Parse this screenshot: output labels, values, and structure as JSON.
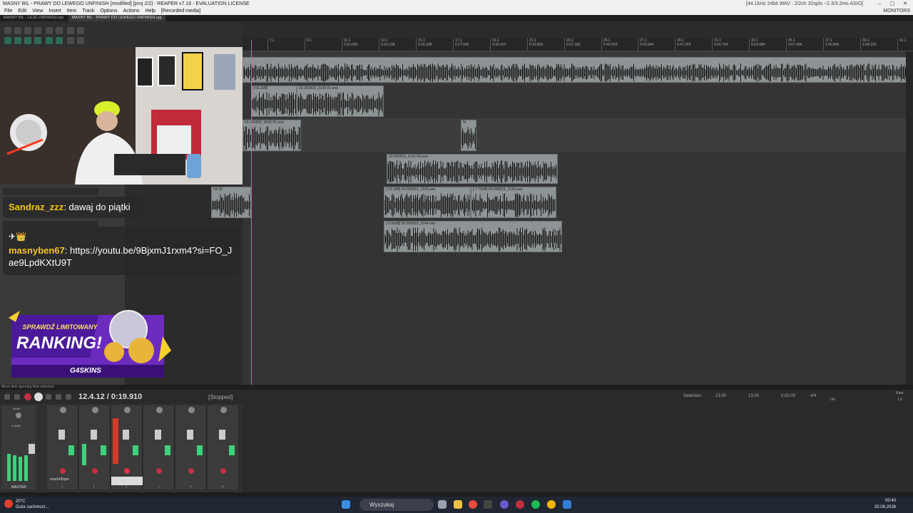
{
  "window": {
    "title": "MASNY BIL - PRAWY DO LEWEGO UNFINISH [modified] [proj 2/2] - REAPER v7.18 - EVALUATION LICENSE",
    "format_info": "[44.1kHz 24bit WAV : 2/2ch 32spls ~2.3/3.2ms ASIO]",
    "minimize": "–",
    "maximize": "▢",
    "close": "✕"
  },
  "menu": {
    "items": [
      "File",
      "Edit",
      "View",
      "Insert",
      "Item",
      "Track",
      "Options",
      "Actions",
      "Help",
      "[Recorded media]"
    ],
    "right": "MONITORS"
  },
  "tabs": [
    "MASNY BIL - LEJE UNFINISH.rpp",
    "MASNY BIL - PRAWY DO LEWEGO UNFINISH.rpp"
  ],
  "ruler": {
    "ticks": [
      {
        "bar": "7.1",
        "time": ""
      },
      {
        "bar": "9.1",
        "time": ""
      },
      {
        "bar": "11.1",
        "time": "0:15.000"
      },
      {
        "bar": "13.1",
        "time": "0:20.138"
      },
      {
        "bar": "15.1",
        "time": "0:25.338"
      },
      {
        "bar": "17.1",
        "time": "0:27.042"
      },
      {
        "bar": "19.1",
        "time": "0:30.423"
      },
      {
        "bar": "21.1",
        "time": "0:33.803"
      },
      {
        "bar": "23.1",
        "time": "0:37.183"
      },
      {
        "bar": "25.1",
        "time": "0:40.563"
      },
      {
        "bar": "27.1",
        "time": "0:43.944"
      },
      {
        "bar": "29.1",
        "time": "0:47.324"
      },
      {
        "bar": "31.1",
        "time": "0:50.704"
      },
      {
        "bar": "33.1",
        "time": "0:54.084"
      },
      {
        "bar": "35.1",
        "time": "0:57.464"
      },
      {
        "bar": "37.1",
        "time": "1:00.845"
      },
      {
        "bar": "39.1",
        "time": "1:04.225"
      },
      {
        "bar": "41.1",
        "time": ""
      }
    ]
  },
  "items": [
    {
      "label": "",
      "lane": 0
    },
    {
      "label": "[-06.2dB]",
      "lane": 1
    },
    {
      "label": "02-260818_2130-01.wav",
      "lane": 1
    },
    {
      "label": "03-260820_0040-01.wav",
      "lane": 2
    },
    {
      "label": "M",
      "lane": 2
    },
    {
      "label": "03-260819_2141-05.wav",
      "lane": 3
    },
    {
      "label": "04-26",
      "lane": 4
    },
    {
      "label": "[-14.3dB] 04-260819_2143.wav",
      "lane": 4
    },
    {
      "label": "[-7.70dB] 04-260819_2143.wav",
      "lane": 4
    },
    {
      "label": "[-9.90dB] 05-260819_2144.wav",
      "lane": 5
    }
  ],
  "chat": [
    {
      "user": "Sandraz_zzz",
      "message": ": dawaj do piątki"
    },
    {
      "badges": "✈👑",
      "user": "masnyben67",
      "message": ": https://youtu.be/9BjxmJ1rxm4?si=FO_Jae9LpdKXtU9T"
    }
  ],
  "promo": {
    "line1": "SPRAWDŹ LIMITOWANY",
    "line2": "RANKING!",
    "brand": "G4SKINS"
  },
  "status_line": "Move item ignoring time selection",
  "transport": {
    "position": "12.4.12 / 0:19.910",
    "state": "[Stopped]",
    "selection_label": "Selection:",
    "sel_start": "13.00",
    "sel_end": "13.00",
    "sel_len": "0.00.00",
    "time_sig": "4/4",
    "bpm": "142",
    "rate_label": "Rate:",
    "rate": "1.0"
  },
  "mixer": {
    "master_label": "MASTER",
    "center_label": "center",
    "track_name": "vixa142bpm",
    "master_db": "0.00dB",
    "strips": [
      "1",
      "2",
      "3",
      "4",
      "5",
      "6"
    ]
  },
  "taskbar": {
    "weather_temp": "20°C",
    "weather_desc": "Duże zachmurz...",
    "search_placeholder": "Wyszukaj",
    "time": "00:40",
    "date": "20.08.2026"
  },
  "colors": {
    "cursor": "#2fb7a8",
    "item": "#8e9496",
    "chat_user": "#f5c518",
    "promo_bg": "#6b2bbf",
    "meter": "#3fd07a",
    "rec": "#e0304a"
  }
}
